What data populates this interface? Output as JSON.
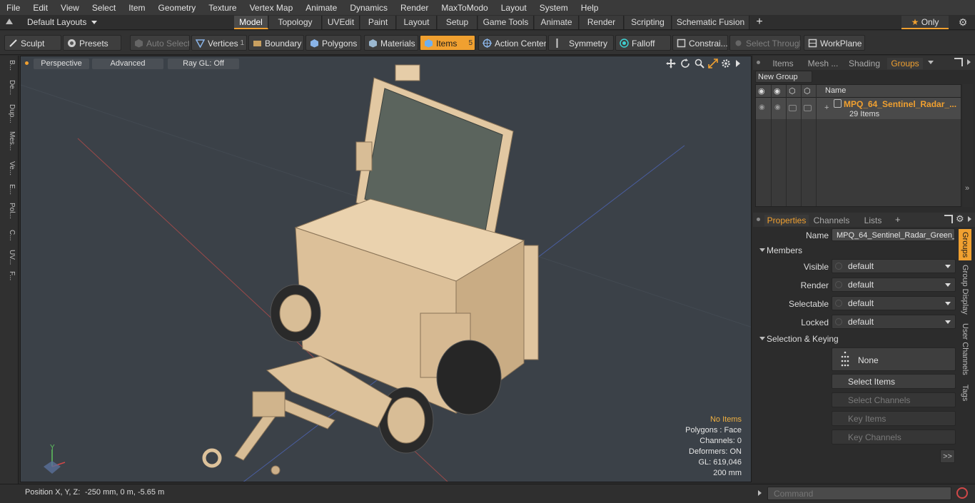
{
  "menu": [
    "File",
    "Edit",
    "View",
    "Select",
    "Item",
    "Geometry",
    "Texture",
    "Vertex Map",
    "Animate",
    "Dynamics",
    "Render",
    "MaxToModo",
    "Layout",
    "System",
    "Help"
  ],
  "layout": {
    "preset": "Default Layouts",
    "tabs": [
      "Model",
      "Topology",
      "UVEdit",
      "Paint",
      "Layout",
      "Setup",
      "Game Tools",
      "Animate",
      "Render",
      "Scripting",
      "Schematic Fusion"
    ],
    "active_tab": "Model",
    "only_label": "Only"
  },
  "toolbar": {
    "sculpt": "Sculpt",
    "presets": "Presets",
    "auto_select": "Auto Select",
    "vertices": "Vertices",
    "vertices_count": "1",
    "boundary": "Boundary",
    "polygons": "Polygons",
    "materials": "Materials",
    "items": "Items",
    "items_count": "5",
    "action_center": "Action Center",
    "symmetry": "Symmetry",
    "falloff": "Falloff",
    "constraints": "Constrai...",
    "select_through": "Select Through",
    "workplane": "WorkPlane"
  },
  "left_strip": [
    "B...",
    "De...",
    "Dup...",
    "Mes...",
    "Ve...",
    "E...",
    "Pol...",
    "C...",
    "UV...",
    "F..."
  ],
  "viewport": {
    "view": "Perspective",
    "shading": "Advanced",
    "raygl": "Ray GL: Off",
    "stats": {
      "no_items": "No Items",
      "polygons": "Polygons : Face",
      "channels": "Channels: 0",
      "deformers": "Deformers: ON",
      "gl": "GL: 619,046",
      "scale": "200 mm"
    },
    "axis_y": "Y",
    "colors": {
      "bg": "#3b4148",
      "model": "#e3c9a4",
      "panel_glass": "#55605a"
    }
  },
  "groups_panel": {
    "tabs": [
      "Items",
      "Mesh ...",
      "Shading",
      "Groups"
    ],
    "active_tab": "Groups",
    "new_group": "New Group",
    "column_name": "Name",
    "group_name": "MPQ_64_Sentinel_Radar_...",
    "group_count": "29 Items"
  },
  "properties": {
    "tabs": [
      "Properties",
      "Channels",
      "Lists"
    ],
    "active_tab": "Properties",
    "name_label": "Name",
    "name_value": "MPQ_64_Sentinel_Radar_Green_",
    "members_label": "Members",
    "visible_label": "Visible",
    "visible_value": "default",
    "render_label": "Render",
    "render_value": "default",
    "selectable_label": "Selectable",
    "selectable_value": "default",
    "locked_label": "Locked",
    "locked_value": "default",
    "selection_keying_label": "Selection & Keying",
    "none_label": "None",
    "select_items": "Select Items",
    "select_channels": "Select Channels",
    "key_items": "Key Items",
    "key_channels": "Key Channels",
    "more": ">>",
    "side_tabs": [
      "Groups",
      "Group Display",
      "User Channels",
      "Tags"
    ]
  },
  "status": {
    "position_label": "Position X, Y, Z:",
    "position_value": "-250 mm, 0 m, -5.65 m",
    "command_placeholder": "Command"
  },
  "accent": "#f0a030"
}
